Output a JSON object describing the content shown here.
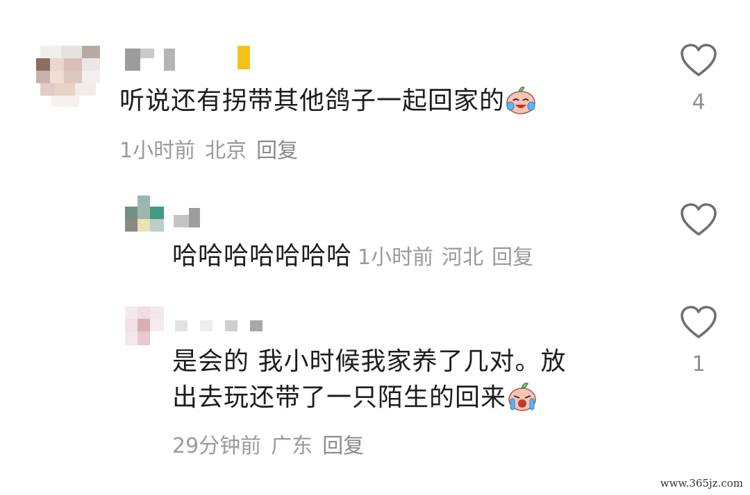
{
  "comments": [
    {
      "text": "听说还有拐带其他鸽子一起回家的",
      "emoji_icon": "crying-laughing-peach-emoji",
      "time": "1小时前",
      "location": "北京",
      "reply_label": "回复",
      "likes": "4"
    }
  ],
  "replies": [
    {
      "text": "哈哈哈哈哈哈哈",
      "time": "1小时前",
      "location": "河北",
      "reply_label": "回复",
      "likes": ""
    },
    {
      "text_line1": "是会的 我小时候我家养了几对。放",
      "text_line2": "出去玩还带了一只陌生的回来",
      "emoji_icon": "crying-peach-emoji",
      "time": "29分钟前",
      "location": "广东",
      "reply_label": "回复",
      "likes": "1"
    }
  ],
  "icons": {
    "like": "heart-outline-icon"
  },
  "colors": {
    "meta": "#9a9a9a",
    "heart_stroke": "#6f6f6f",
    "accent_yellow": "#f2c21a"
  },
  "watermark": "www.365jz.com"
}
